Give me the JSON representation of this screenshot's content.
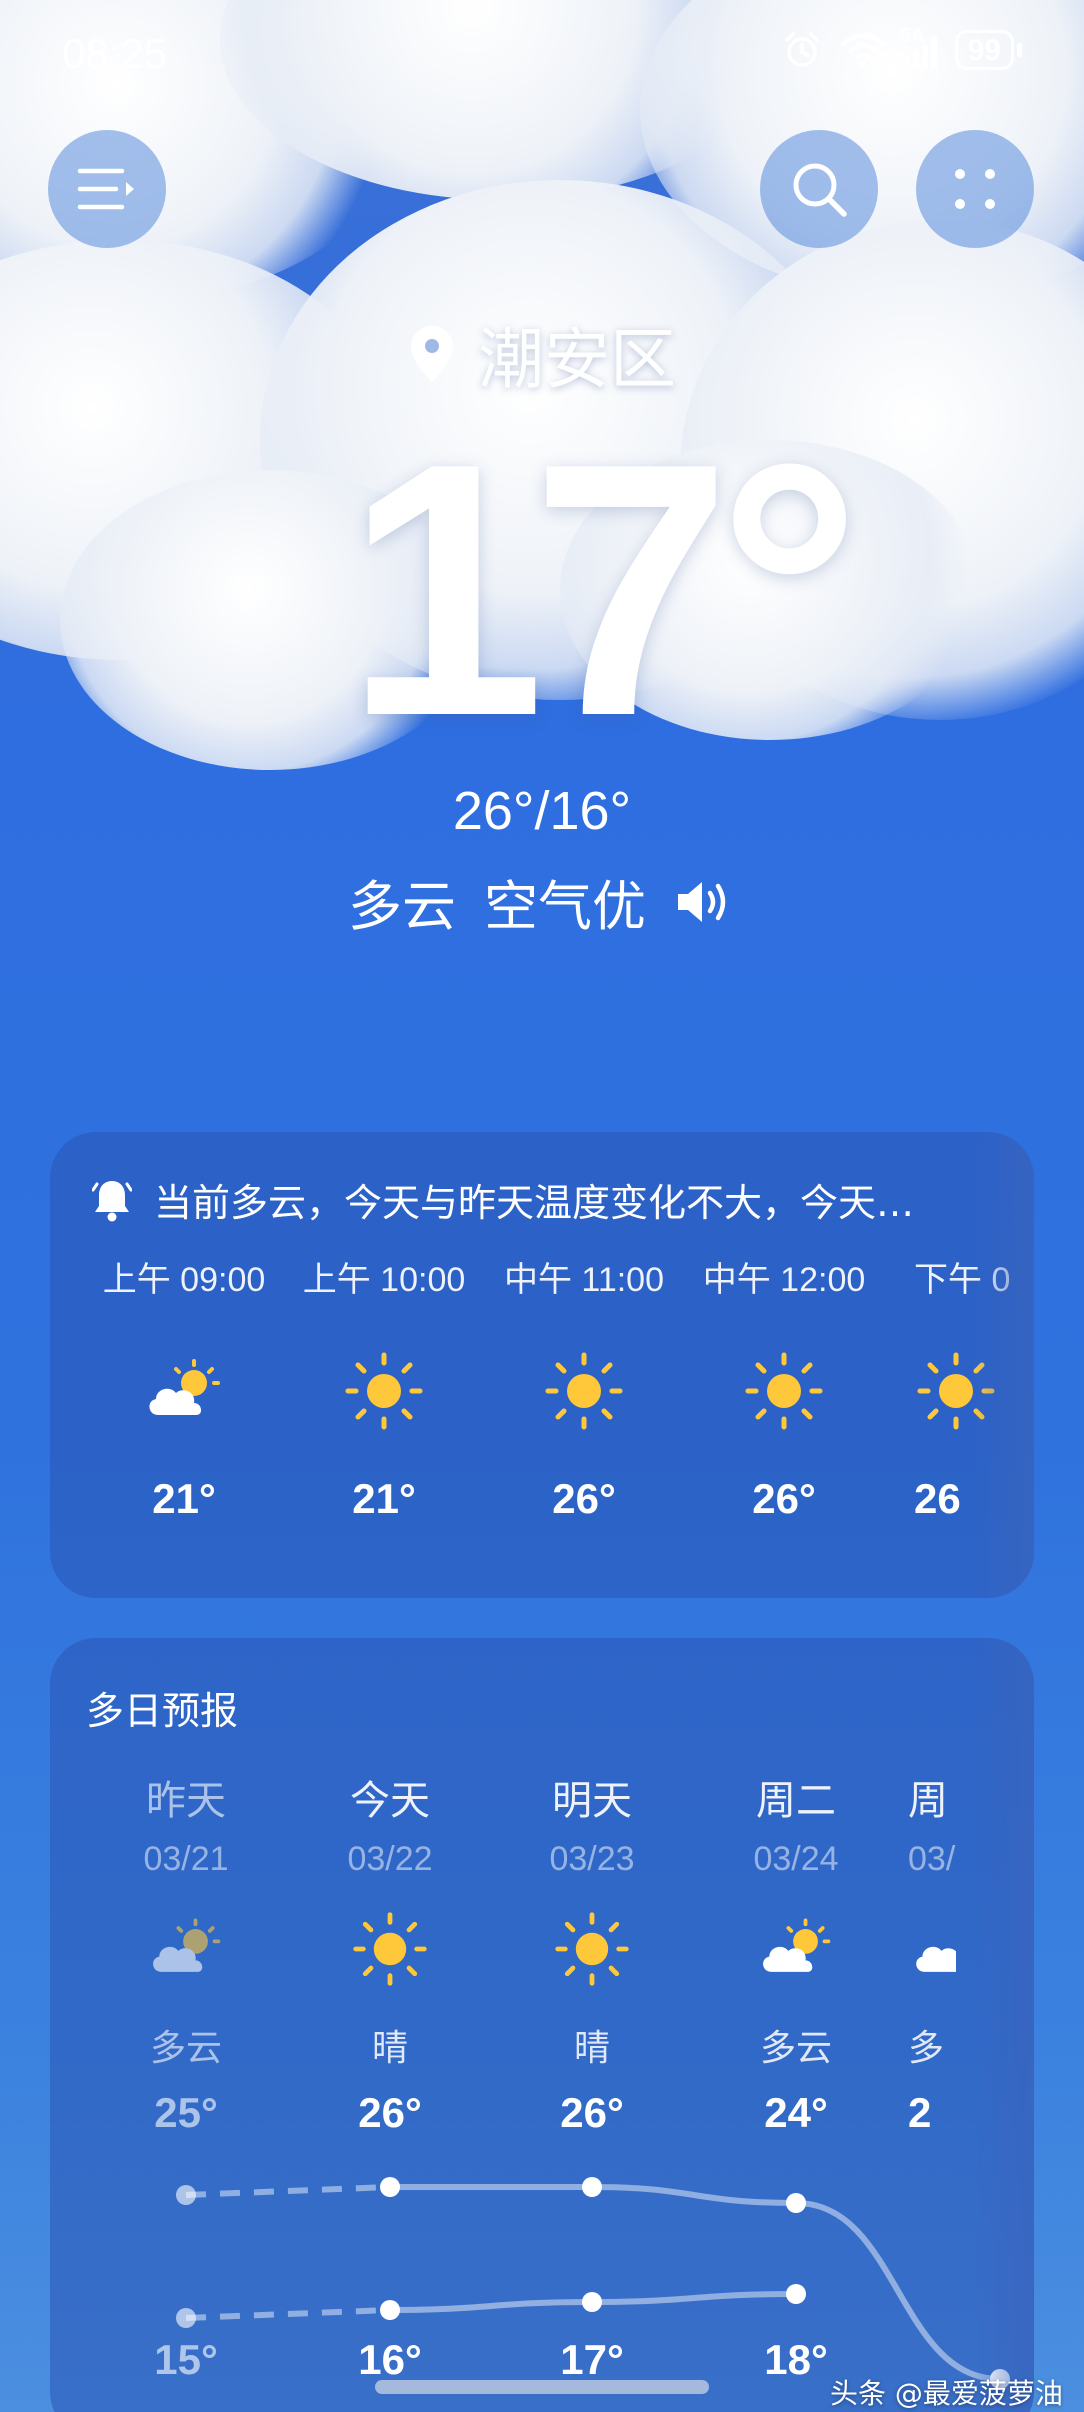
{
  "status_bar": {
    "time": "08:25",
    "network": "5A",
    "battery": "99"
  },
  "location": "潮安区",
  "current": {
    "temperature": "17°",
    "high_low": "26°/16°",
    "condition": "多云",
    "air_quality": "空气优"
  },
  "alert_text": "当前多云，今天与昨天温度变化不大，今天…",
  "hourly": [
    {
      "time": "上午 09:00",
      "icon": "partly-cloudy-icon",
      "temp": "21°"
    },
    {
      "time": "上午 10:00",
      "icon": "sun-icon",
      "temp": "21°"
    },
    {
      "time": "中午 11:00",
      "icon": "sun-icon",
      "temp": "26°"
    },
    {
      "time": "中午 12:00",
      "icon": "sun-icon",
      "temp": "26°"
    },
    {
      "time": "下午 0",
      "icon": "sun-icon",
      "temp": "26"
    }
  ],
  "daily_title": "多日预报",
  "daily": [
    {
      "day": "昨天",
      "date": "03/21",
      "icon": "partly-cloudy-icon",
      "condition": "多云",
      "high": "25°",
      "low": "15°"
    },
    {
      "day": "今天",
      "date": "03/22",
      "icon": "sun-icon",
      "condition": "晴",
      "high": "26°",
      "low": "16°"
    },
    {
      "day": "明天",
      "date": "03/23",
      "icon": "sun-icon",
      "condition": "晴",
      "high": "26°",
      "low": "17°"
    },
    {
      "day": "周二",
      "date": "03/24",
      "icon": "partly-cloudy-icon",
      "condition": "多云",
      "high": "24°",
      "low": "18°"
    },
    {
      "day": "周",
      "date": "03/",
      "icon": "partly-cloudy-icon",
      "condition": "多",
      "high": "2",
      "low": ""
    }
  ],
  "watermark": "头条 @最爱菠萝油",
  "colors": {
    "sky_blue": "#2f6ee0",
    "card": "#2a56b4",
    "sun": "#ffc83a"
  }
}
